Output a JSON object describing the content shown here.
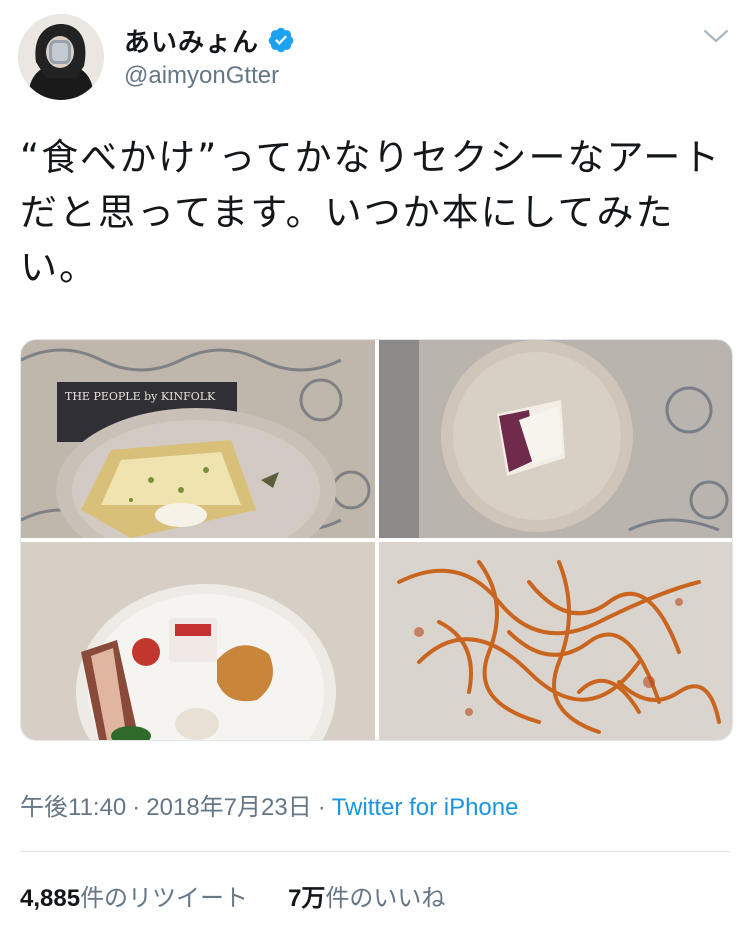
{
  "user": {
    "display_name": "あいみょん",
    "handle": "@aimyonGtter",
    "verified": true
  },
  "tweet": {
    "text": "“食べかけ”ってかなりセクシーなアートだと思ってます。いつか本にしてみたい。",
    "photo_book_text": "THE PEOPLE by KINFOLK",
    "time": "午後11:40",
    "date": "2018年7月23日",
    "separator": "·",
    "source": "Twitter for iPhone"
  },
  "stats": {
    "retweets_count": "4,885",
    "retweets_label": "件のリツイート",
    "likes_count": "7万",
    "likes_label": "件のいいね"
  },
  "colors": {
    "link": "#1b95e0",
    "verified_badge": "#1da1f2",
    "secondary_text": "#657786"
  },
  "icons": [
    "verified-badge-icon",
    "chevron-down-icon"
  ]
}
